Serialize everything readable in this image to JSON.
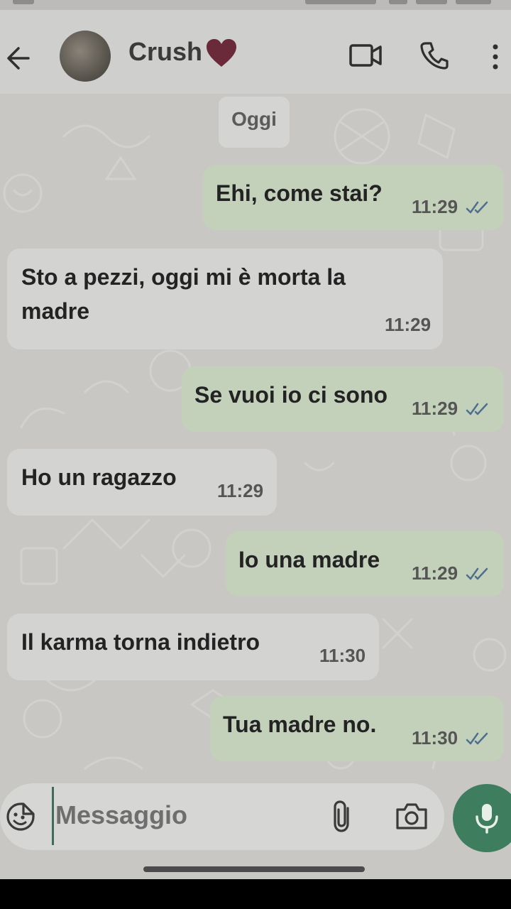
{
  "header": {
    "contact_name": "Crush",
    "back_icon": "arrow-left-icon",
    "heart_icon": "heart-icon",
    "video_icon": "video-camera-icon",
    "call_icon": "phone-icon",
    "menu_icon": "more-vertical-icon"
  },
  "chat": {
    "date_label": "Oggi",
    "messages": [
      {
        "direction": "out",
        "text": "Ehi, come stai?",
        "time": "11:29",
        "read": true
      },
      {
        "direction": "in",
        "text": "Sto a pezzi, oggi mi è morta la madre",
        "time": "11:29"
      },
      {
        "direction": "out",
        "text": "Se vuoi io ci sono",
        "time": "11:29",
        "read": true
      },
      {
        "direction": "in",
        "text": "Ho un ragazzo",
        "time": "11:29"
      },
      {
        "direction": "out",
        "text": "Io una madre",
        "time": "11:29",
        "read": true
      },
      {
        "direction": "in",
        "text": "Il karma torna indietro",
        "time": "11:30"
      },
      {
        "direction": "out",
        "text": "Tua madre no.",
        "time": "11:30",
        "read": true
      }
    ]
  },
  "input": {
    "placeholder": "Messaggio",
    "emoji_icon": "sticker-emoji-icon",
    "attach_icon": "paperclip-icon",
    "camera_icon": "camera-icon",
    "mic_icon": "microphone-icon"
  },
  "colors": {
    "outgoing_bubble": "#c3d1bb",
    "incoming_bubble": "#d3d3d1",
    "accent_green": "#3e7d5e",
    "read_ticks": "#4f6f8f"
  }
}
